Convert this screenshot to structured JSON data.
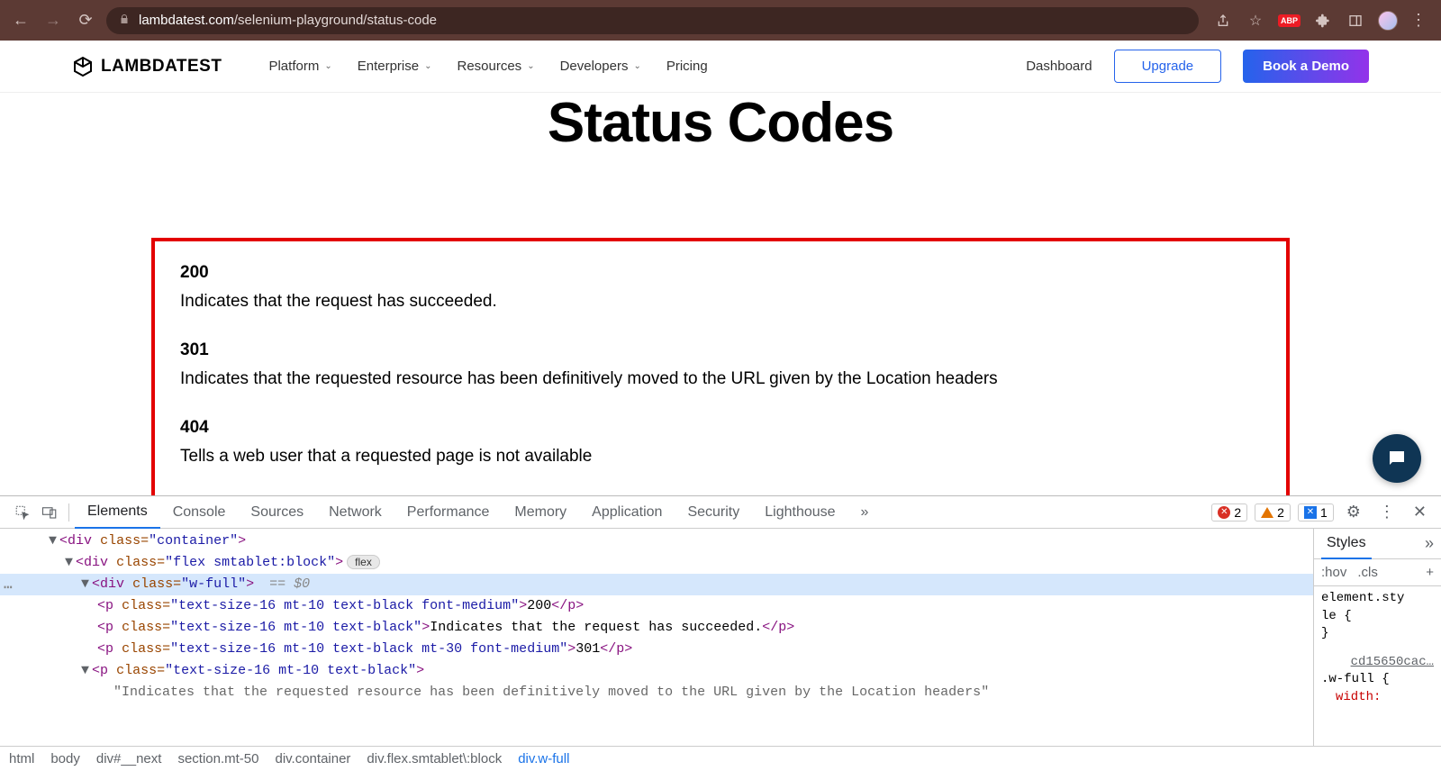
{
  "browser": {
    "url_domain": "lambdatest.com",
    "url_path": "/selenium-playground/status-code",
    "abp": "ABP"
  },
  "header": {
    "logo": "LAMBDATEST",
    "nav": [
      "Platform",
      "Enterprise",
      "Resources",
      "Developers",
      "Pricing"
    ],
    "dashboard": "Dashboard",
    "upgrade": "Upgrade",
    "book": "Book a Demo"
  },
  "page": {
    "title": "Status Codes",
    "statuses": [
      {
        "code": "200",
        "desc": "Indicates that the request has succeeded."
      },
      {
        "code": "301",
        "desc": "Indicates that the requested resource has been definitively moved to the URL given by the Location headers"
      },
      {
        "code": "404",
        "desc": "Tells a web user that a requested page is not available"
      }
    ]
  },
  "devtools": {
    "tabs": [
      "Elements",
      "Console",
      "Sources",
      "Network",
      "Performance",
      "Memory",
      "Application",
      "Security",
      "Lighthouse"
    ],
    "errors": "2",
    "warnings": "2",
    "issues": "1",
    "styles_tab": "Styles",
    "hov": ":hov",
    "cls": ".cls",
    "rule1_sel": "element.sty\nle {",
    "rule1_close": "}",
    "rule2_link": "cd15650cac…",
    "rule2_sel": ".w-full {",
    "rule2_prop": "width:",
    "breadcrumb": [
      "html",
      "body",
      "div#__next",
      "section.mt-50",
      "div.container",
      "div.flex.smtablet\\:block",
      "div.w-full"
    ]
  },
  "dom": {
    "l1": {
      "indent": "      ",
      "caret": "▼",
      "tag": "div",
      "attr": "class",
      "val": "container"
    },
    "l2": {
      "indent": "        ",
      "caret": "▼",
      "tag": "div",
      "attr": "class",
      "val": "flex smtablet:block",
      "badge": "flex"
    },
    "l3": {
      "indent": "          ",
      "caret": "▼",
      "tag": "div",
      "attr": "class",
      "val": "w-full",
      "marker": " == ",
      "dollar": "$0"
    },
    "l4": {
      "indent": "            ",
      "tag": "p",
      "attr": "class",
      "val": "text-size-16 mt-10 text-black font-medium",
      "text": "200"
    },
    "l5": {
      "indent": "            ",
      "tag": "p",
      "attr": "class",
      "val": "text-size-16 mt-10 text-black",
      "text": "Indicates that the request has succeeded."
    },
    "l6": {
      "indent": "            ",
      "tag": "p",
      "attr": "class",
      "val": "text-size-16 mt-10 text-black mt-30 font-medium",
      "text": "301"
    },
    "l7": {
      "indent": "          ",
      "caret": "▼",
      "tag": "p",
      "attr": "class",
      "val": "text-size-16 mt-10 text-black"
    },
    "l8": {
      "indent": "              ",
      "text": "\"Indicates that the requested resource has been definitively moved to the URL given by the Location headers\""
    }
  }
}
